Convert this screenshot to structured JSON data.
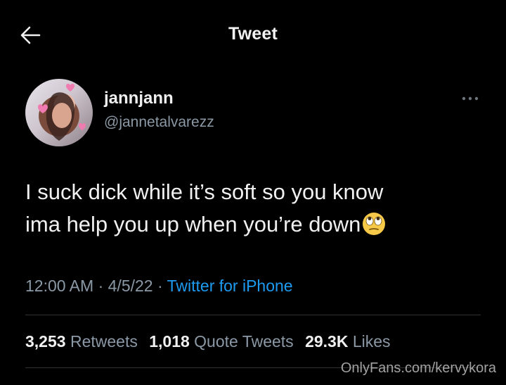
{
  "header": {
    "title": "Tweet"
  },
  "author": {
    "display_name": "jannjann",
    "handle": "@jannetalvarezz"
  },
  "tweet": {
    "text_line1": "I suck dick while it’s soft so you know",
    "text_line2": "ima help you up when you’re down",
    "emoji": "face-with-rolling-eyes"
  },
  "meta": {
    "time": "12:00 AM",
    "sep1": " · ",
    "date": "4/5/22",
    "sep2": " · ",
    "source": "Twitter for iPhone"
  },
  "stats": {
    "retweets_count": "3,253",
    "retweets_label": "Retweets",
    "quotes_count": "1,018",
    "quotes_label": "Quote Tweets",
    "likes_count": "29.3K",
    "likes_label": "Likes"
  },
  "watermark": "OnlyFans.com/kervykora",
  "colors": {
    "background": "#000000",
    "accent": "#1d9bf0",
    "secondary": "#8b98a5"
  }
}
